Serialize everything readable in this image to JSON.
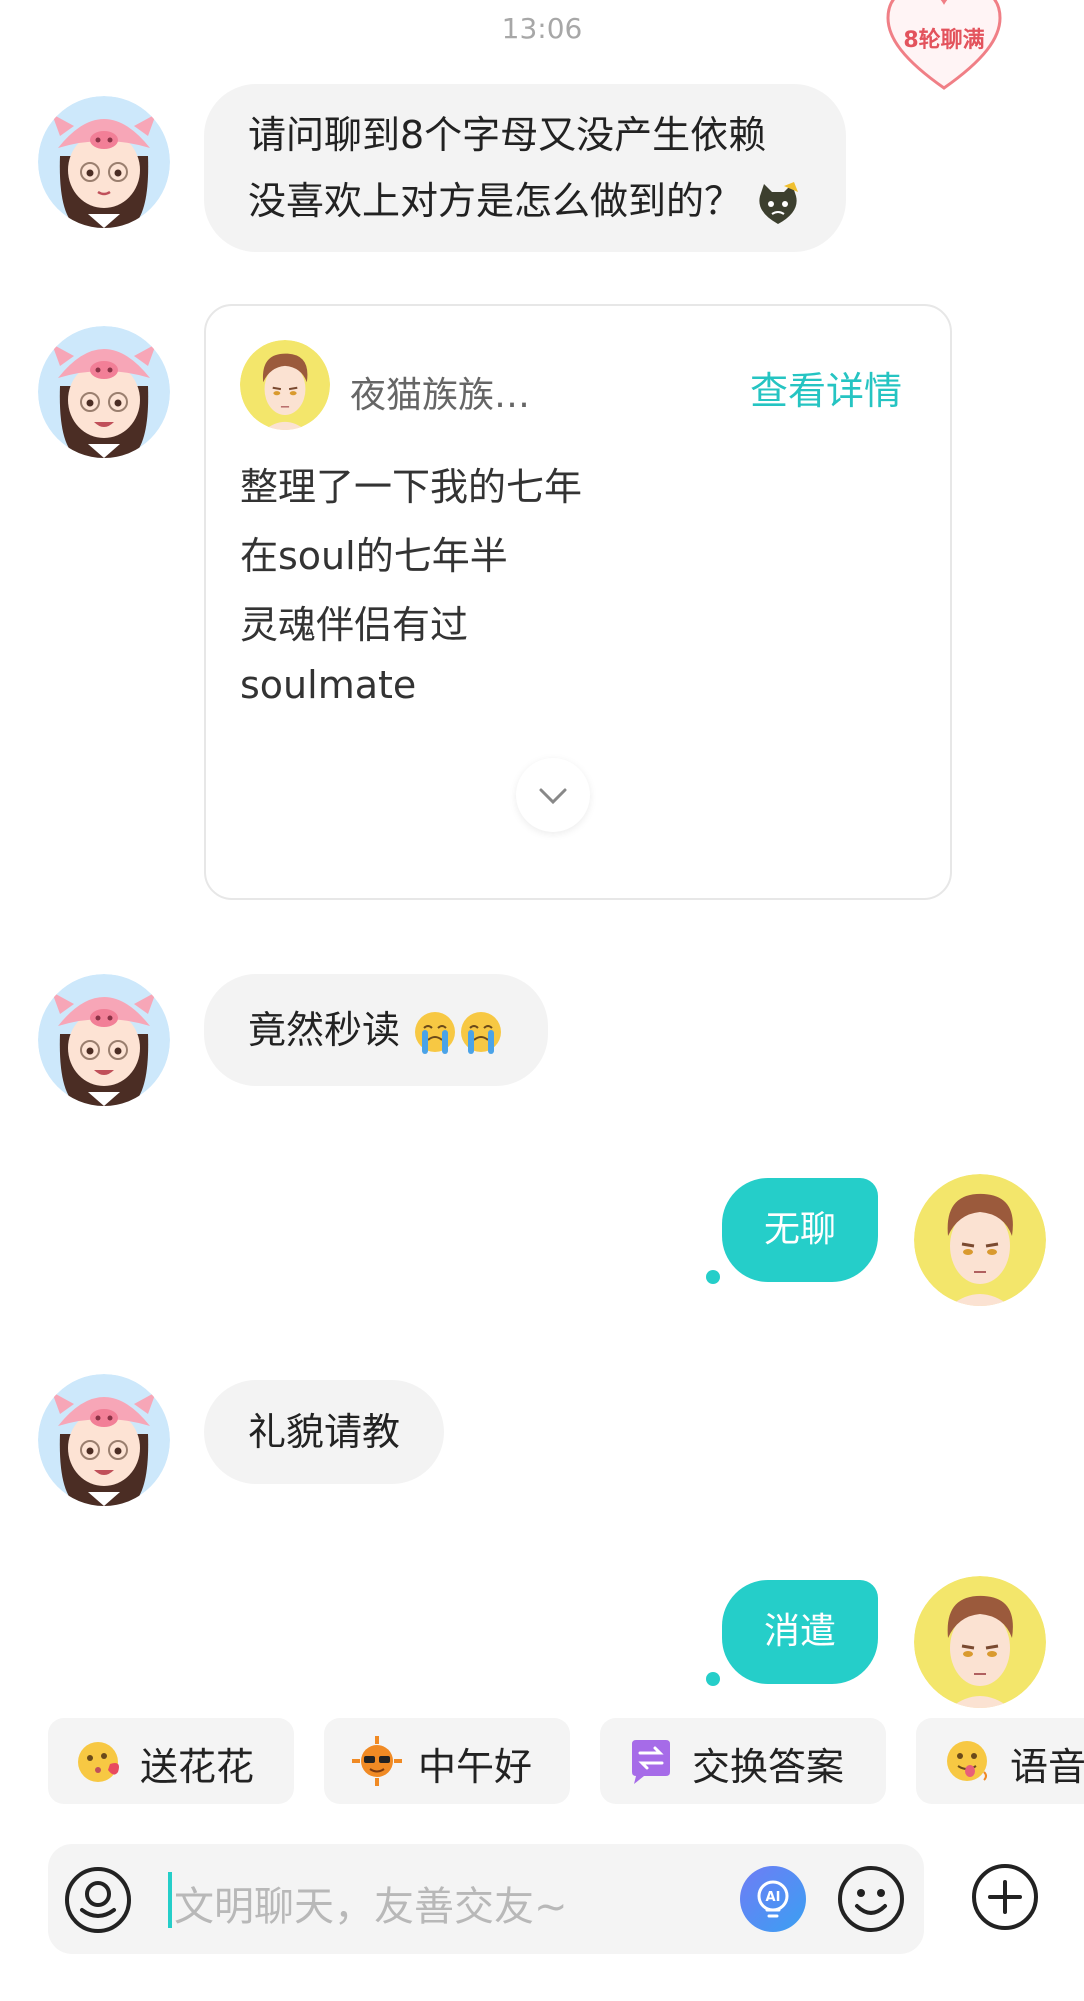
{
  "status": {
    "time": "13:06"
  },
  "badge": {
    "label": "8轮聊满"
  },
  "messages": [
    {
      "side": "left",
      "lines": [
        "请问聊到8个字母又没产生依赖",
        "没喜欢上对方是怎么做到的？"
      ]
    },
    {
      "side": "left",
      "type": "card",
      "card": {
        "author": "夜猫族族…",
        "action": "查看详情",
        "lines": [
          "整理了一下我的七年",
          "在soul的七年半",
          "灵魂伴侣有过",
          "soulmate"
        ]
      }
    },
    {
      "side": "left",
      "text": "竟然秒读"
    },
    {
      "side": "right",
      "text": "无聊"
    },
    {
      "side": "left",
      "text": "礼貌请教"
    },
    {
      "side": "right",
      "text": "消遣"
    }
  ],
  "quick_replies": [
    {
      "label": "送花花",
      "icon": "kiss-emoji-icon"
    },
    {
      "label": "中午好",
      "icon": "sun-sunglasses-icon"
    },
    {
      "label": "交换答案",
      "icon": "swap-icon"
    },
    {
      "label": "语音",
      "icon": "tongue-emoji-icon"
    }
  ],
  "input": {
    "placeholder": "文明聊天，友善交友~"
  },
  "colors": {
    "accent": "#25cec9",
    "bubble_left": "#f3f3f3",
    "detail": "#25c4c2",
    "badge": "#e3535d"
  }
}
